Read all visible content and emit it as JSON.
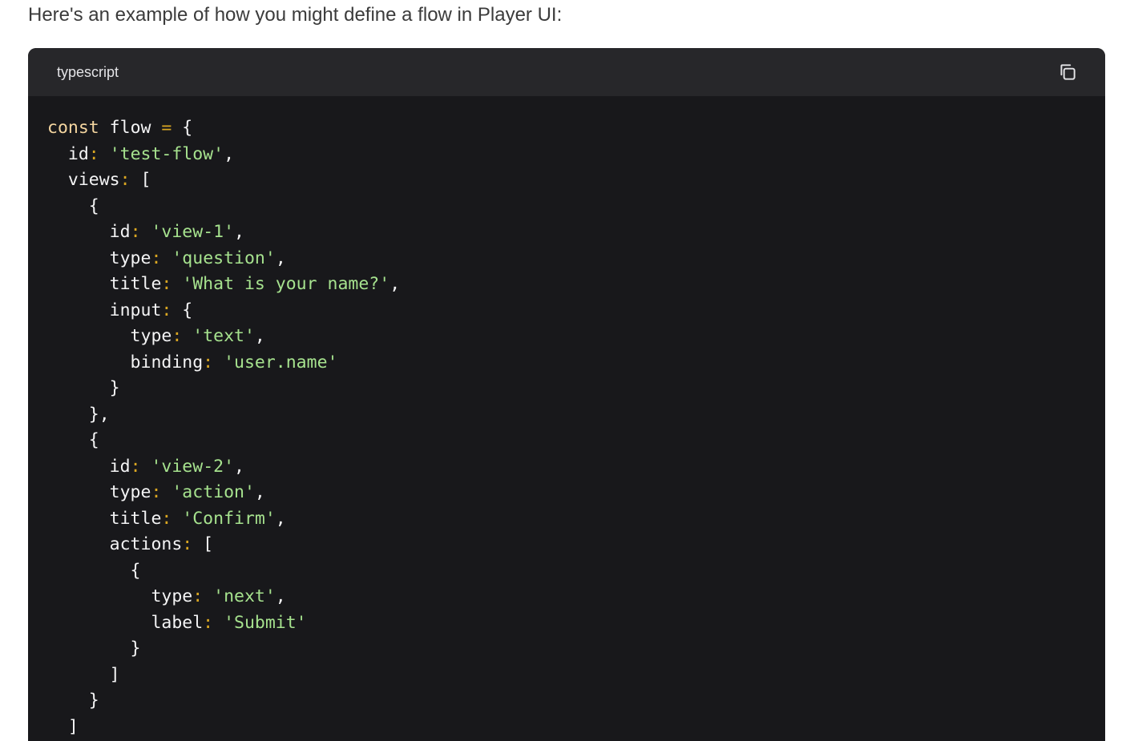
{
  "intro_text": "Here's an example of how you might define a flow in Player UI:",
  "code_block": {
    "language_label": "typescript",
    "copy_icon": "copy-icon",
    "lines": [
      [
        {
          "t": "kw",
          "v": "const"
        },
        {
          "t": "plain",
          "v": " flow "
        },
        {
          "t": "pun",
          "v": "="
        },
        {
          "t": "plain",
          "v": " {"
        }
      ],
      [
        {
          "t": "plain",
          "v": "  id"
        },
        {
          "t": "pun",
          "v": ":"
        },
        {
          "t": "plain",
          "v": " "
        },
        {
          "t": "str",
          "v": "'test-flow'"
        },
        {
          "t": "plain",
          "v": ","
        }
      ],
      [
        {
          "t": "plain",
          "v": "  views"
        },
        {
          "t": "pun",
          "v": ":"
        },
        {
          "t": "plain",
          "v": " ["
        }
      ],
      [
        {
          "t": "plain",
          "v": "    {"
        }
      ],
      [
        {
          "t": "plain",
          "v": "      id"
        },
        {
          "t": "pun",
          "v": ":"
        },
        {
          "t": "plain",
          "v": " "
        },
        {
          "t": "str",
          "v": "'view-1'"
        },
        {
          "t": "plain",
          "v": ","
        }
      ],
      [
        {
          "t": "plain",
          "v": "      type"
        },
        {
          "t": "pun",
          "v": ":"
        },
        {
          "t": "plain",
          "v": " "
        },
        {
          "t": "str",
          "v": "'question'"
        },
        {
          "t": "plain",
          "v": ","
        }
      ],
      [
        {
          "t": "plain",
          "v": "      title"
        },
        {
          "t": "pun",
          "v": ":"
        },
        {
          "t": "plain",
          "v": " "
        },
        {
          "t": "str",
          "v": "'What is your name?'"
        },
        {
          "t": "plain",
          "v": ","
        }
      ],
      [
        {
          "t": "plain",
          "v": "      input"
        },
        {
          "t": "pun",
          "v": ":"
        },
        {
          "t": "plain",
          "v": " {"
        }
      ],
      [
        {
          "t": "plain",
          "v": "        type"
        },
        {
          "t": "pun",
          "v": ":"
        },
        {
          "t": "plain",
          "v": " "
        },
        {
          "t": "str",
          "v": "'text'"
        },
        {
          "t": "plain",
          "v": ","
        }
      ],
      [
        {
          "t": "plain",
          "v": "        binding"
        },
        {
          "t": "pun",
          "v": ":"
        },
        {
          "t": "plain",
          "v": " "
        },
        {
          "t": "str",
          "v": "'user.name'"
        }
      ],
      [
        {
          "t": "plain",
          "v": "      }"
        }
      ],
      [
        {
          "t": "plain",
          "v": "    },"
        }
      ],
      [
        {
          "t": "plain",
          "v": "    {"
        }
      ],
      [
        {
          "t": "plain",
          "v": "      id"
        },
        {
          "t": "pun",
          "v": ":"
        },
        {
          "t": "plain",
          "v": " "
        },
        {
          "t": "str",
          "v": "'view-2'"
        },
        {
          "t": "plain",
          "v": ","
        }
      ],
      [
        {
          "t": "plain",
          "v": "      type"
        },
        {
          "t": "pun",
          "v": ":"
        },
        {
          "t": "plain",
          "v": " "
        },
        {
          "t": "str",
          "v": "'action'"
        },
        {
          "t": "plain",
          "v": ","
        }
      ],
      [
        {
          "t": "plain",
          "v": "      title"
        },
        {
          "t": "pun",
          "v": ":"
        },
        {
          "t": "plain",
          "v": " "
        },
        {
          "t": "str",
          "v": "'Confirm'"
        },
        {
          "t": "plain",
          "v": ","
        }
      ],
      [
        {
          "t": "plain",
          "v": "      actions"
        },
        {
          "t": "pun",
          "v": ":"
        },
        {
          "t": "plain",
          "v": " ["
        }
      ],
      [
        {
          "t": "plain",
          "v": "        {"
        }
      ],
      [
        {
          "t": "plain",
          "v": "          type"
        },
        {
          "t": "pun",
          "v": ":"
        },
        {
          "t": "plain",
          "v": " "
        },
        {
          "t": "str",
          "v": "'next'"
        },
        {
          "t": "plain",
          "v": ","
        }
      ],
      [
        {
          "t": "plain",
          "v": "          label"
        },
        {
          "t": "pun",
          "v": ":"
        },
        {
          "t": "plain",
          "v": " "
        },
        {
          "t": "str",
          "v": "'Submit'"
        }
      ],
      [
        {
          "t": "plain",
          "v": "        }"
        }
      ],
      [
        {
          "t": "plain",
          "v": "      ]"
        }
      ],
      [
        {
          "t": "plain",
          "v": "    }"
        }
      ],
      [
        {
          "t": "plain",
          "v": "  ]"
        }
      ]
    ]
  },
  "colors": {
    "code_background": "#18181b",
    "header_background": "#27272a",
    "keyword": "#f5d6a0",
    "string": "#a6e28e",
    "text": "#f4f4f5"
  }
}
